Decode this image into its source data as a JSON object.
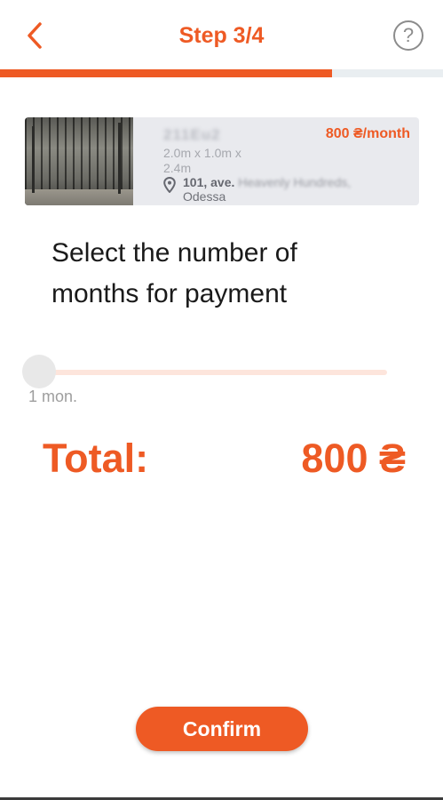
{
  "header": {
    "title": "Step 3/4",
    "back_icon": "chevron-left-icon",
    "help_label": "?",
    "help_icon": "question-circle-icon"
  },
  "progress": {
    "fraction": 0.75
  },
  "listing": {
    "id": "211Eu2",
    "size": "2.0m x 1.0m x 2.4m",
    "price": "800 ₴/month",
    "address_number": "101, ave.",
    "address_street": "Heavenly Hundreds,",
    "address_city": "Odessa",
    "location_icon": "map-pin-icon"
  },
  "heading": "Select the number of months for payment",
  "slider": {
    "value_label": "1 mon.",
    "position": 0
  },
  "total": {
    "label": "Total:",
    "value": "800 ₴"
  },
  "confirm_label": "Confirm",
  "colors": {
    "accent": "#ee5a24",
    "track": "#fde5dc",
    "progress_bg": "#e9eef1",
    "card_bg": "#e9eaee"
  }
}
